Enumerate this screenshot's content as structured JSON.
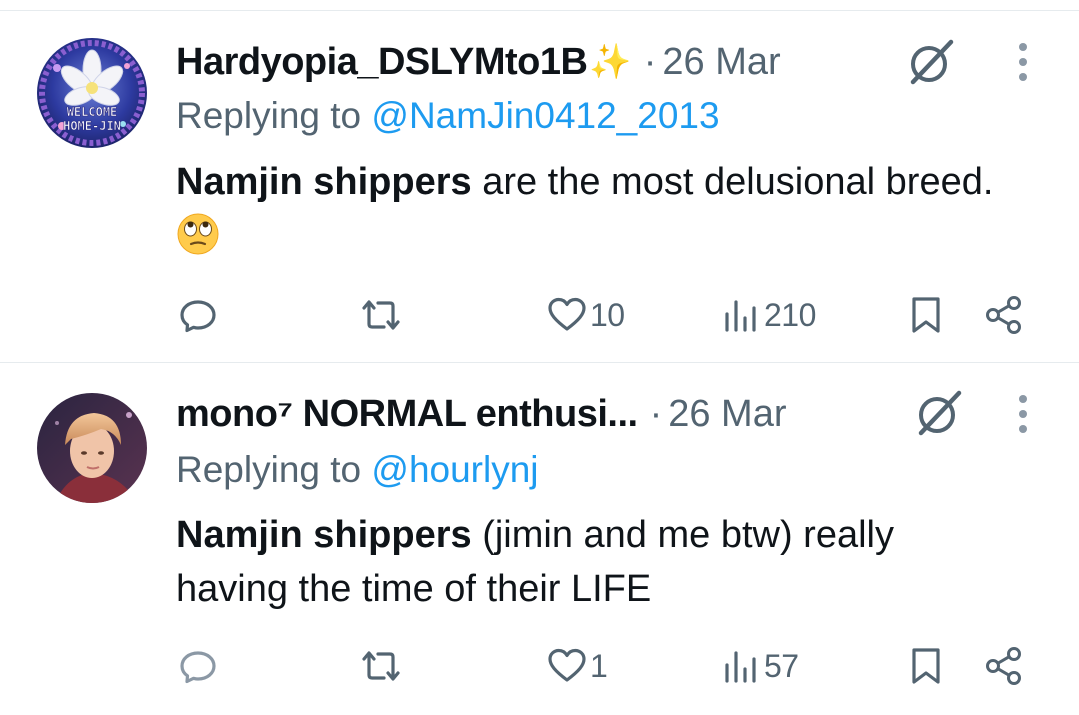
{
  "tweets": [
    {
      "display_name": "Hardyopia_DSLYMto1B",
      "name_emoji": "✨",
      "separator": "·",
      "time": "26 Mar",
      "replying_prefix": "Replying to ",
      "replying_handle": "@NamJin0412_2013",
      "body_bold": "Namjin shippers",
      "body_rest": " are the most delusional breed. ",
      "body_emoji": "face-with-rolling-eyes",
      "avatar_text_1": "WELCOME",
      "avatar_text_2": "HOME-JIN",
      "actions": {
        "replies": "",
        "retweets": "",
        "likes": "10",
        "views": "210"
      }
    },
    {
      "display_name": "mono⁷ NORMAL enthusi...",
      "separator": "·",
      "time": "26 Mar",
      "replying_prefix": "Replying to ",
      "replying_handle": "@hourlynj",
      "body_bold": "Namjin shippers",
      "body_rest": " (jimin and me btw) really having the time of their LIFE",
      "actions": {
        "replies": "",
        "retweets": "",
        "likes": "1",
        "views": "57"
      }
    }
  ],
  "icons": [
    "grok-icon",
    "more-icon",
    "reply-icon",
    "retweet-icon",
    "like-icon",
    "views-icon",
    "bookmark-icon",
    "share-icon"
  ],
  "colors": {
    "text": "#0f1419",
    "secondary": "#536471",
    "link": "#1d9bf0",
    "divider": "#e6ebee"
  }
}
